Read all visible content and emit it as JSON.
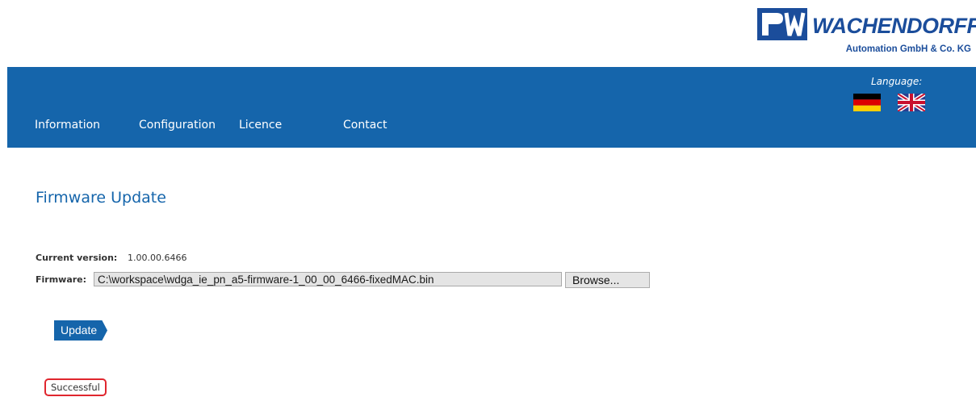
{
  "logo": {
    "name": "WACHENDORFF",
    "subtitle": "Automation GmbH & Co. KG"
  },
  "nav": {
    "items": [
      {
        "label": "Information"
      },
      {
        "label": "Configuration"
      },
      {
        "label": "Licence"
      },
      {
        "label": "Contact"
      }
    ],
    "language_label": "Language:",
    "flags": [
      "german-flag-icon",
      "uk-flag-icon"
    ]
  },
  "page": {
    "title": "Firmware Update",
    "current_version_label": "Current version:",
    "current_version_value": "1.00.00.6466",
    "firmware_label": "Firmware:",
    "firmware_path": "C:\\workspace\\wdga_ie_pn_a5-firmware-1_00_00_6466-fixedMAC.bin",
    "browse_label": "Browse...",
    "update_label": "Update",
    "status_text": "Successful"
  },
  "colors": {
    "brand_blue": "#1565ab",
    "logo_blue": "#1b4d9b",
    "status_border": "#e0262e"
  }
}
